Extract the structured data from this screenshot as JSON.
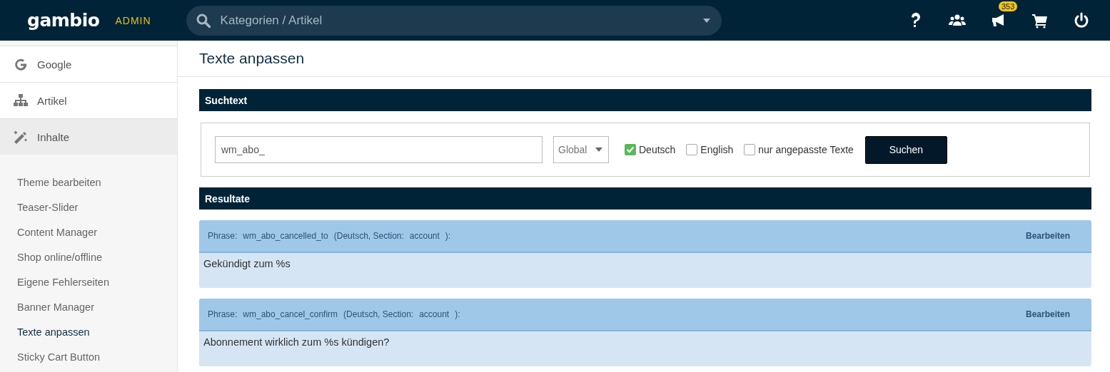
{
  "header": {
    "logo": "gambio",
    "badge": "ADMIN",
    "search": {
      "placeholder": "Kategorien / Artikel"
    },
    "icons": [
      {
        "kind": "help"
      },
      {
        "kind": "users"
      },
      {
        "kind": "megaphone",
        "count": "353"
      },
      {
        "kind": "cart"
      },
      {
        "kind": "power"
      }
    ]
  },
  "sidebar": {
    "items": [
      {
        "kind": "google",
        "label": "Google",
        "selected": false
      },
      {
        "kind": "tree",
        "label": "Artikel",
        "selected": false
      },
      {
        "kind": "wand",
        "label": "Inhalte",
        "selected": true
      }
    ],
    "subitems": [
      {
        "label": "Theme bearbeiten",
        "selected": false
      },
      {
        "label": "Teaser-Slider",
        "selected": false
      },
      {
        "label": "Content Manager",
        "selected": false
      },
      {
        "label": "Shop online/offline",
        "selected": false
      },
      {
        "label": "Eigene Fehlerseiten",
        "selected": false
      },
      {
        "label": "Banner Manager",
        "selected": false
      },
      {
        "label": "Texte anpassen",
        "selected": true
      },
      {
        "label": "Sticky Cart Button",
        "selected": false
      }
    ]
  },
  "page_title": "Texte anpassen",
  "search_section": {
    "title": "Suchtext",
    "query": "wm_abo_",
    "scope": "Global",
    "languages": [
      {
        "label": "Deutsch",
        "checked": true
      },
      {
        "label": "English",
        "checked": false
      },
      {
        "label": "nur angepasste Texte",
        "checked": false
      }
    ],
    "button": "Suchen"
  },
  "results_section": {
    "title": "Resultate",
    "results": [
      {
        "phrase_label": "Phrase:",
        "phrase": "wm_abo_cancelled_to",
        "meta": "(Deutsch, Section:",
        "section": "account",
        "close": "):",
        "edit": "Bearbeiten",
        "text": "Gekündigt zum %s"
      },
      {
        "phrase_label": "Phrase:",
        "phrase": "wm_abo_cancel_confirm",
        "meta": "(Deutsch, Section:",
        "section": "account",
        "close": "):",
        "edit": "Bearbeiten",
        "text": "Abonnement wirklich zum %s kündigen?"
      }
    ]
  }
}
